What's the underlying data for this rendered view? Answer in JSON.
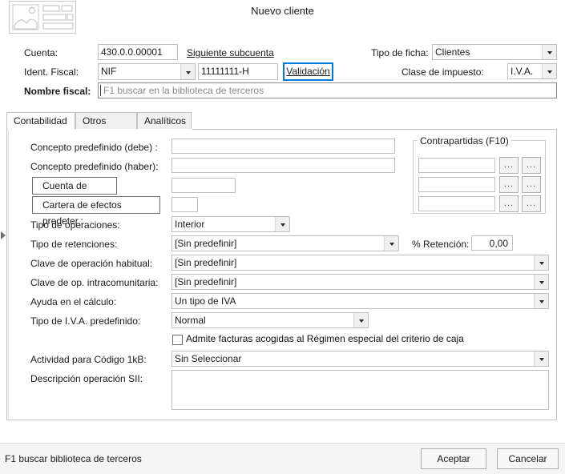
{
  "window": {
    "title": "Nuevo cliente",
    "thumbnail_icon": "image-placeholder-icon"
  },
  "form": {
    "cuenta": {
      "label": "Cuenta:",
      "value": "430.0.0.00001"
    },
    "siguiente_subcuenta_link": "Siguiente subcuenta",
    "tipo_ficha": {
      "label": "Tipo de ficha:",
      "value": "Clientes"
    },
    "ident_fiscal": {
      "label": "Ident. Fiscal:",
      "type_value": "NIF",
      "number_value": "11111111-H"
    },
    "validacion_button": "Validación",
    "clase_impuesto": {
      "label": "Clase de impuesto:",
      "value": "I.V.A."
    },
    "nombre_fiscal": {
      "label": "Nombre fiscal:",
      "value": "",
      "placeholder": "F1 buscar en la biblioteca de terceros"
    }
  },
  "tabs": [
    {
      "label": "Contabilidad",
      "active": true
    },
    {
      "label": "Otros datos",
      "active": false
    },
    {
      "label": "Analíticos",
      "active": false
    }
  ],
  "contabilidad": {
    "concepto_debe": {
      "label": "Concepto predefinido (debe) :",
      "value": ""
    },
    "concepto_haber": {
      "label": "Concepto predefinido (haber):",
      "value": ""
    },
    "cuenta_banco": {
      "label": "Cuenta de banco:",
      "value": ""
    },
    "cartera_efectos": {
      "label": "Cartera de efectos predeter.:",
      "value": ""
    },
    "tipo_operaciones": {
      "label": "Tipo de operaciones:",
      "value": "Interior"
    },
    "tipo_retenciones": {
      "label": "Tipo de retenciones:",
      "value": "[Sin predefinir]"
    },
    "porc_retencion": {
      "label": "% Retención:",
      "value": "0,00"
    },
    "clave_operacion_habitual": {
      "label": "Clave de operación habitual:",
      "value": "[Sin predefinir]"
    },
    "clave_op_intracomunitaria": {
      "label": "Clave de op. intracomunitaria:",
      "value": "[Sin predefinir]"
    },
    "ayuda_calculo": {
      "label": "Ayuda en el cálculo:",
      "value": "Un tipo de IVA"
    },
    "tipo_iva_predefinido": {
      "label": "Tipo de I.V.A. predefinido:",
      "value": "Normal"
    },
    "criterio_caja": {
      "label": "Admite facturas acogidas al Régimen especial del criterio de caja",
      "checked": false
    },
    "actividad_codigo": {
      "label": "Actividad para Código 1kB:",
      "value": "Sin Seleccionar"
    },
    "descripcion_sii": {
      "label": "Descripción operación SII:",
      "value": ""
    }
  },
  "contrapartidas": {
    "title": "Contrapartidas (F10)",
    "rows": [
      {
        "value": "",
        "btn1": "...",
        "btn2": "..."
      },
      {
        "value": "",
        "btn1": "...",
        "btn2": "..."
      },
      {
        "value": "",
        "btn1": "...",
        "btn2": "..."
      }
    ]
  },
  "statusbar": {
    "hint": "F1 buscar biblioteca de terceros",
    "accept_button": "Aceptar",
    "cancel_button": "Cancelar"
  },
  "colors": {
    "accent": "#0078d7",
    "panel_bg": "#ffffff",
    "status_bg": "#f5f5f5",
    "border": "#c2c2c2"
  }
}
